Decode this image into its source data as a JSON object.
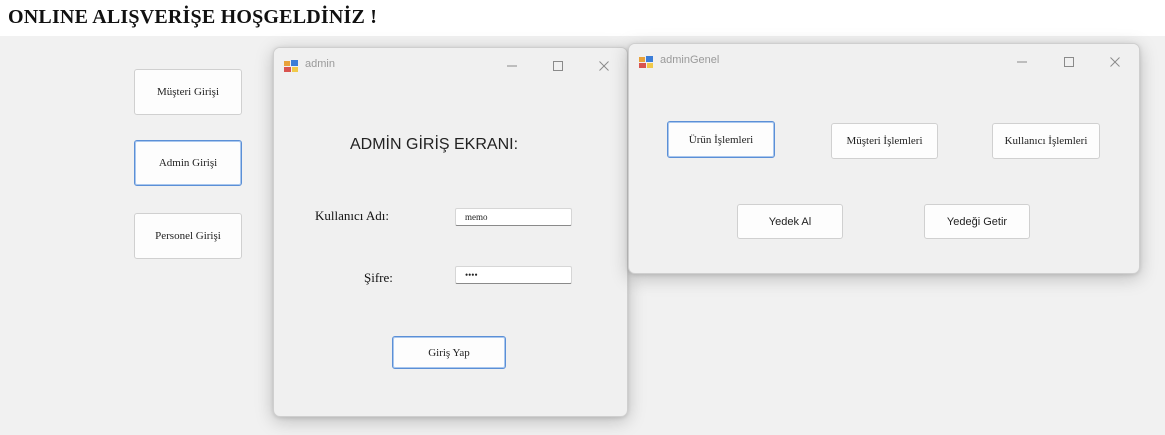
{
  "main": {
    "title": "ONLINE ALIŞVERİŞE HOŞGELDİNİZ !",
    "buttons": {
      "musteri": "Müşteri Girişi",
      "admin": "Admin Girişi",
      "personel": "Personel Girişi"
    }
  },
  "admin_window": {
    "title": "admin",
    "heading": "ADMİN GİRİŞ EKRANI:",
    "username_label": "Kullanıcı Adı:",
    "username_value": "memo",
    "password_label": "Şifre:",
    "password_value": "••••",
    "login_button": "Giriş Yap"
  },
  "admingenel_window": {
    "title": "adminGenel",
    "buttons": {
      "urun": "Ürün İşlemleri",
      "musteri": "Müşteri İşlemleri",
      "kullanici": "Kullanıcı İşlemleri",
      "yedek_al": "Yedek Al",
      "yedegi_getir": "Yedeği Getir"
    }
  },
  "colors": {
    "accent": "#5b8fd6",
    "window_bg": "#f0f0f0",
    "title_text": "#9a9a9a"
  },
  "icons": [
    "app-icon",
    "minimize-icon",
    "maximize-icon",
    "close-icon"
  ]
}
